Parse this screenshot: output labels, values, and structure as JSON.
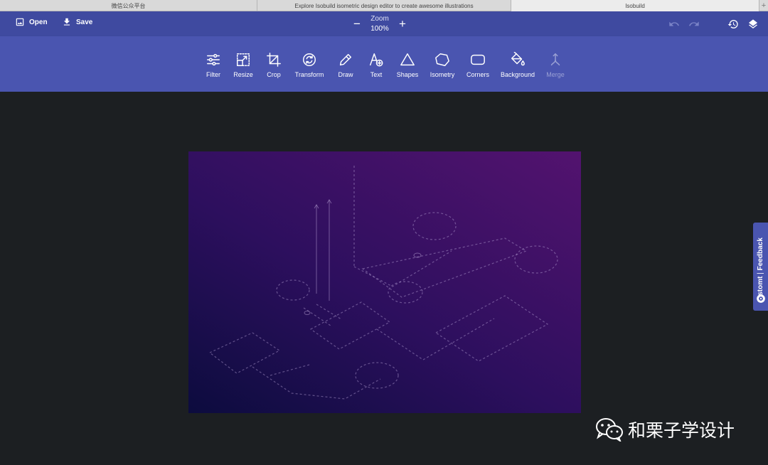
{
  "browser": {
    "tabs": [
      {
        "title": "微信公众平台"
      },
      {
        "title": "Explore Isobuild isometric design editor to create awesome illustrations"
      },
      {
        "title": "Isobuild"
      }
    ],
    "new_tab_label": "+"
  },
  "header": {
    "open_label": "Open",
    "save_label": "Save",
    "zoom_label": "Zoom",
    "zoom_value": "100%",
    "zoom_minus": "−",
    "zoom_plus": "+",
    "icons": [
      "image-icon",
      "download-icon",
      "undo-icon",
      "redo-icon",
      "history-icon",
      "layers-icon"
    ]
  },
  "toolbar": {
    "tools": [
      {
        "label": "Filter",
        "icon": "sliders-icon",
        "enabled": true
      },
      {
        "label": "Resize",
        "icon": "resize-icon",
        "enabled": true
      },
      {
        "label": "Crop",
        "icon": "crop-icon",
        "enabled": true
      },
      {
        "label": "Transform",
        "icon": "rotate-icon",
        "enabled": true
      },
      {
        "label": "Draw",
        "icon": "pencil-icon",
        "enabled": true
      },
      {
        "label": "Text",
        "icon": "text-add-icon",
        "enabled": true
      },
      {
        "label": "Shapes",
        "icon": "triangle-icon",
        "enabled": true
      },
      {
        "label": "Isometry",
        "icon": "pentagon-icon",
        "enabled": true
      },
      {
        "label": "Corners",
        "icon": "rounded-rect-icon",
        "enabled": true
      },
      {
        "label": "Background",
        "icon": "paint-bucket-icon",
        "enabled": true
      },
      {
        "label": "Merge",
        "icon": "merge-icon",
        "enabled": false
      }
    ]
  },
  "feedback": {
    "brand": "stomt",
    "separator": " | ",
    "label": "Feedback"
  },
  "watermark": {
    "text": "和栗子学设计"
  },
  "colors": {
    "header_bg": "#3f4aa0",
    "toolbar_bg": "#4a55b0",
    "workspace_bg": "#1c1f22",
    "canvas_gradient": [
      "#0c0c3e",
      "#53136f"
    ]
  }
}
